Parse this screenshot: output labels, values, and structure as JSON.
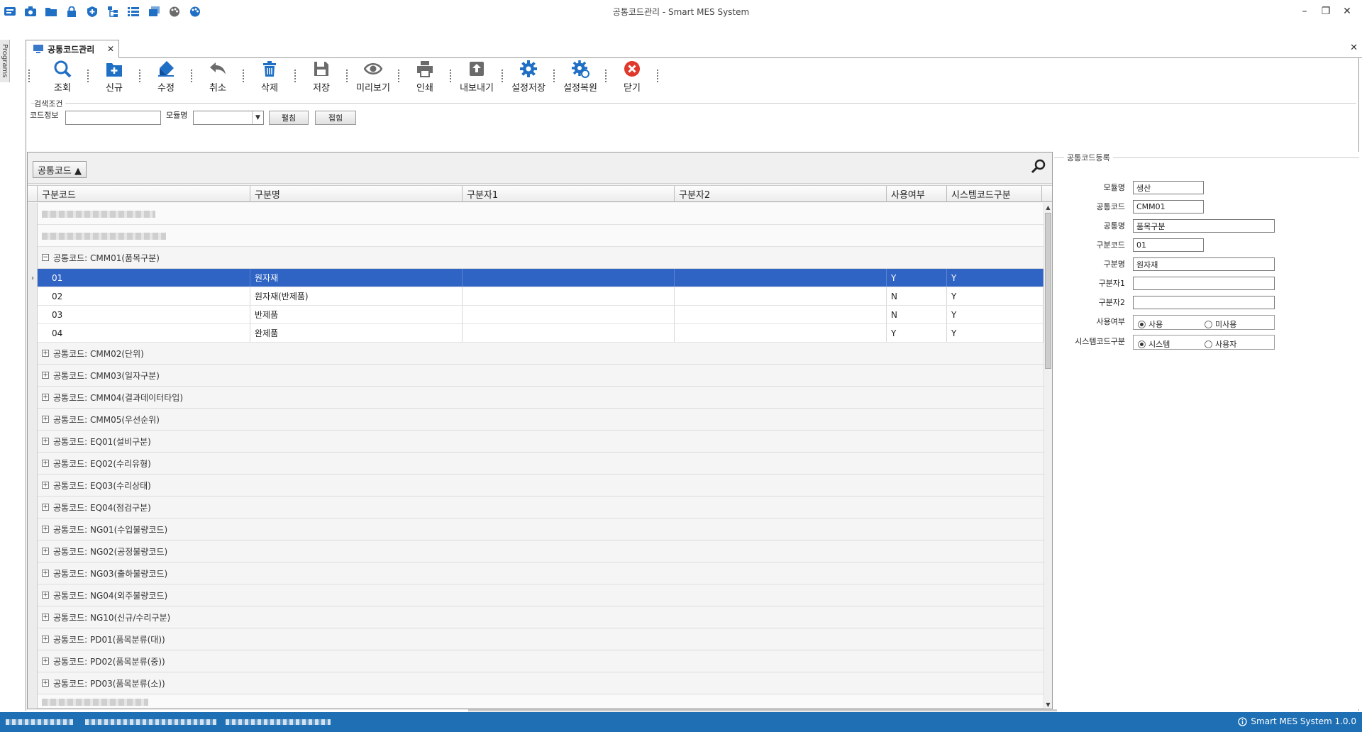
{
  "window": {
    "title": "공통코드관리 - Smart MES System"
  },
  "side": {
    "label": "Programs"
  },
  "tab": {
    "label": "공통코드관리"
  },
  "toolbar": {
    "buttons": [
      {
        "label": "조회"
      },
      {
        "label": "신규"
      },
      {
        "label": "수정"
      },
      {
        "label": "취소"
      },
      {
        "label": "삭제"
      },
      {
        "label": "저장"
      },
      {
        "label": "미리보기"
      },
      {
        "label": "인쇄"
      },
      {
        "label": "내보내기"
      },
      {
        "label": "설정저장"
      },
      {
        "label": "설정복원"
      },
      {
        "label": "닫기"
      }
    ],
    "colors": {
      "blue": "#1f6fc5",
      "gray": "#6b6b6b",
      "close_red": "#e0392b"
    }
  },
  "search": {
    "legend": "검색조건",
    "code_label": "코드정보",
    "code_value": "",
    "module_label": "모듈명",
    "module_value": "",
    "expand_label": "펼침",
    "collapse_label": "접힘"
  },
  "grid": {
    "group_chip": "공통코드 ▲",
    "columns": [
      "구분코드",
      "구분명",
      "구분자1",
      "구분자2",
      "사용여부",
      "시스템코드구분"
    ],
    "expanded_group": "공통코드: CMM01(품목구분)",
    "rows": [
      [
        "01",
        "원자재",
        "",
        "",
        "Y",
        "Y"
      ],
      [
        "02",
        "원자재(반제품)",
        "",
        "",
        "N",
        "Y"
      ],
      [
        "03",
        "반제품",
        "",
        "",
        "N",
        "Y"
      ],
      [
        "04",
        "완제품",
        "",
        "",
        "Y",
        "Y"
      ]
    ],
    "collapsed_groups": [
      "공통코드: CMM02(단위)",
      "공통코드: CMM03(일자구분)",
      "공통코드: CMM04(결과데이터타입)",
      "공통코드: CMM05(우선순위)",
      "공통코드: EQ01(설비구분)",
      "공통코드: EQ02(수리유형)",
      "공통코드: EQ03(수리상태)",
      "공통코드: EQ04(점검구분)",
      "공통코드: NG01(수입불량코드)",
      "공통코드: NG02(공정불량코드)",
      "공통코드: NG03(출하불량코드)",
      "공통코드: NG04(외주불량코드)",
      "공통코드: NG10(신규/수리구분)",
      "공통코드: PD01(품목분류(대))",
      "공통코드: PD02(품목분류(중))",
      "공통코드: PD03(품목분류(소))"
    ],
    "selected_color": "#2f63c4"
  },
  "register": {
    "legend": "공통코드등록",
    "module_label": "모듈명",
    "module_value": "생산",
    "code_label": "공통코드",
    "code_value": "CMM01",
    "name_label": "공통명",
    "name_value": "품목구분",
    "sub_code_label": "구분코드",
    "sub_code_value": "01",
    "sub_name_label": "구분명",
    "sub_name_value": "원자재",
    "sep1_label": "구분자1",
    "sep1_value": "",
    "sep2_label": "구분자2",
    "sep2_value": "",
    "use_label": "사용여부",
    "use_yes": "사용",
    "use_no": "미사용",
    "sys_label": "시스템코드구분",
    "sys_yes": "시스템",
    "sys_no": "사용자"
  },
  "status": {
    "right_text": "Smart MES System 1.0.0",
    "bg": "#1e6fb4"
  }
}
